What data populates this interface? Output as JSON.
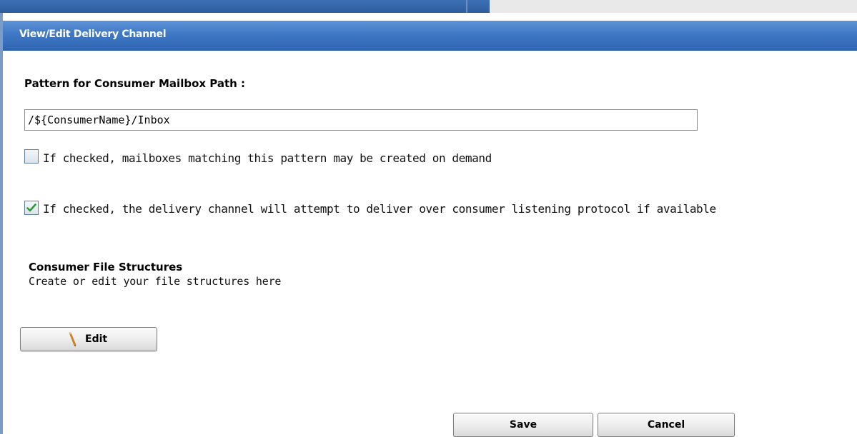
{
  "dialog": {
    "title": "View/Edit Delivery Channel"
  },
  "mailbox_path": {
    "label": "Pattern for Consumer Mailbox Path :",
    "value": "/${ConsumerName}/Inbox"
  },
  "options": [
    {
      "checked": false,
      "label": "If checked, mailboxes matching this pattern may be created on demand"
    },
    {
      "checked": true,
      "label": "If checked, the delivery channel will attempt to deliver over consumer listening protocol if available"
    }
  ],
  "file_structures": {
    "heading": "Consumer File Structures",
    "description": "Create or edit your file structures here",
    "edit_label": "Edit",
    "edit_icon": "pencil-icon"
  },
  "footer": {
    "save_label": "Save",
    "cancel_label": "Cancel"
  },
  "colors": {
    "titlebar": "#3f78c4",
    "check_mark": "#2e9a3a"
  }
}
